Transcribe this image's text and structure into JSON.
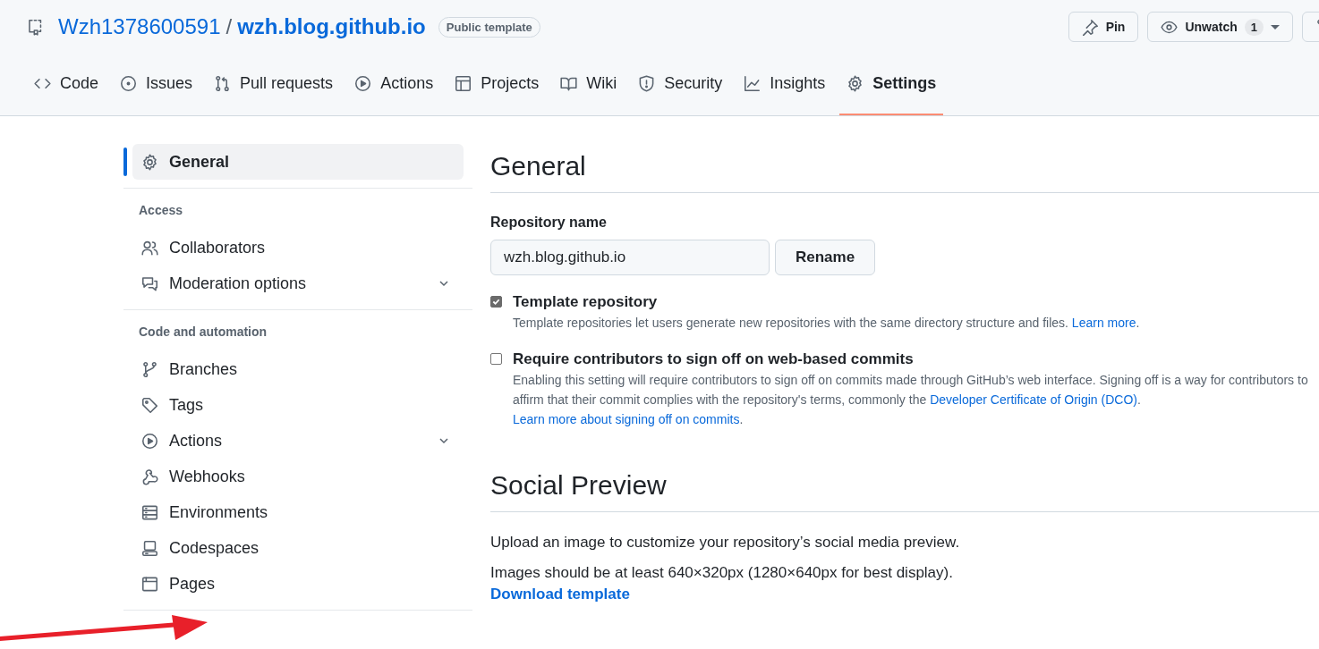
{
  "repo": {
    "owner": "Wzh1378600591",
    "separator": "/",
    "name": "wzh.blog.github.io",
    "badge": "Public template"
  },
  "actions": [
    {
      "kind": "pin",
      "label": "Pin"
    },
    {
      "kind": "watch",
      "label": "Unwatch",
      "count": "1"
    },
    {
      "kind": "fork"
    }
  ],
  "tabs": [
    {
      "label": "Code",
      "selected": false
    },
    {
      "label": "Issues",
      "selected": false
    },
    {
      "label": "Pull requests",
      "selected": false
    },
    {
      "label": "Actions",
      "selected": false
    },
    {
      "label": "Projects",
      "selected": false
    },
    {
      "label": "Wiki",
      "selected": false
    },
    {
      "label": "Security",
      "selected": false
    },
    {
      "label": "Insights",
      "selected": false
    },
    {
      "label": "Settings",
      "selected": true
    }
  ],
  "sidebar": {
    "top": [
      {
        "label": "General",
        "selected": true
      }
    ],
    "sections": [
      {
        "heading": "Access",
        "items": [
          {
            "label": "Collaborators",
            "selected": false,
            "kind": "link"
          },
          {
            "label": "Moderation options",
            "selected": false,
            "kind": "group"
          }
        ]
      },
      {
        "heading": "Code and automation",
        "items": [
          {
            "label": "Branches",
            "selected": false,
            "kind": "link"
          },
          {
            "label": "Tags",
            "selected": false,
            "kind": "link"
          },
          {
            "label": "Actions",
            "selected": false,
            "kind": "group"
          },
          {
            "label": "Webhooks",
            "selected": false,
            "kind": "link"
          },
          {
            "label": "Environments",
            "selected": false,
            "kind": "link"
          },
          {
            "label": "Codespaces",
            "selected": false,
            "kind": "link"
          },
          {
            "label": "Pages",
            "selected": false,
            "kind": "link"
          }
        ]
      }
    ]
  },
  "general": {
    "title": "General",
    "repo_name_label": "Repository name",
    "repo_name_value": "wzh.blog.github.io",
    "rename_button": "Rename",
    "options": [
      {
        "label": "Template repository",
        "checked": true,
        "description": [
          {
            "kind": "text",
            "text": "Template repositories let users generate new repositories with the same directory structure and files. "
          },
          {
            "kind": "link",
            "text": "Learn more"
          },
          {
            "kind": "text",
            "text": "."
          }
        ]
      },
      {
        "label": "Require contributors to sign off on web-based commits",
        "checked": false,
        "description": [
          {
            "kind": "text",
            "text": "Enabling this setting will require contributors to sign off on commits made through GitHub’s web interface. Signing off is a way for contributors to affirm that their commit complies with the repository's terms, commonly the "
          },
          {
            "kind": "link",
            "text": "Developer Certificate of Origin (DCO)"
          },
          {
            "kind": "text",
            "text": ". "
          },
          {
            "kind": "link",
            "text": "Learn more about signing off on commits"
          },
          {
            "kind": "text",
            "text": "."
          }
        ]
      }
    ]
  },
  "social_preview": {
    "title": "Social Preview",
    "text": "Upload an image to customize your repository’s social media preview.",
    "size_hint": "Images should be at least 640×320px (1280×640px for best display).",
    "download_link": "Download template"
  }
}
